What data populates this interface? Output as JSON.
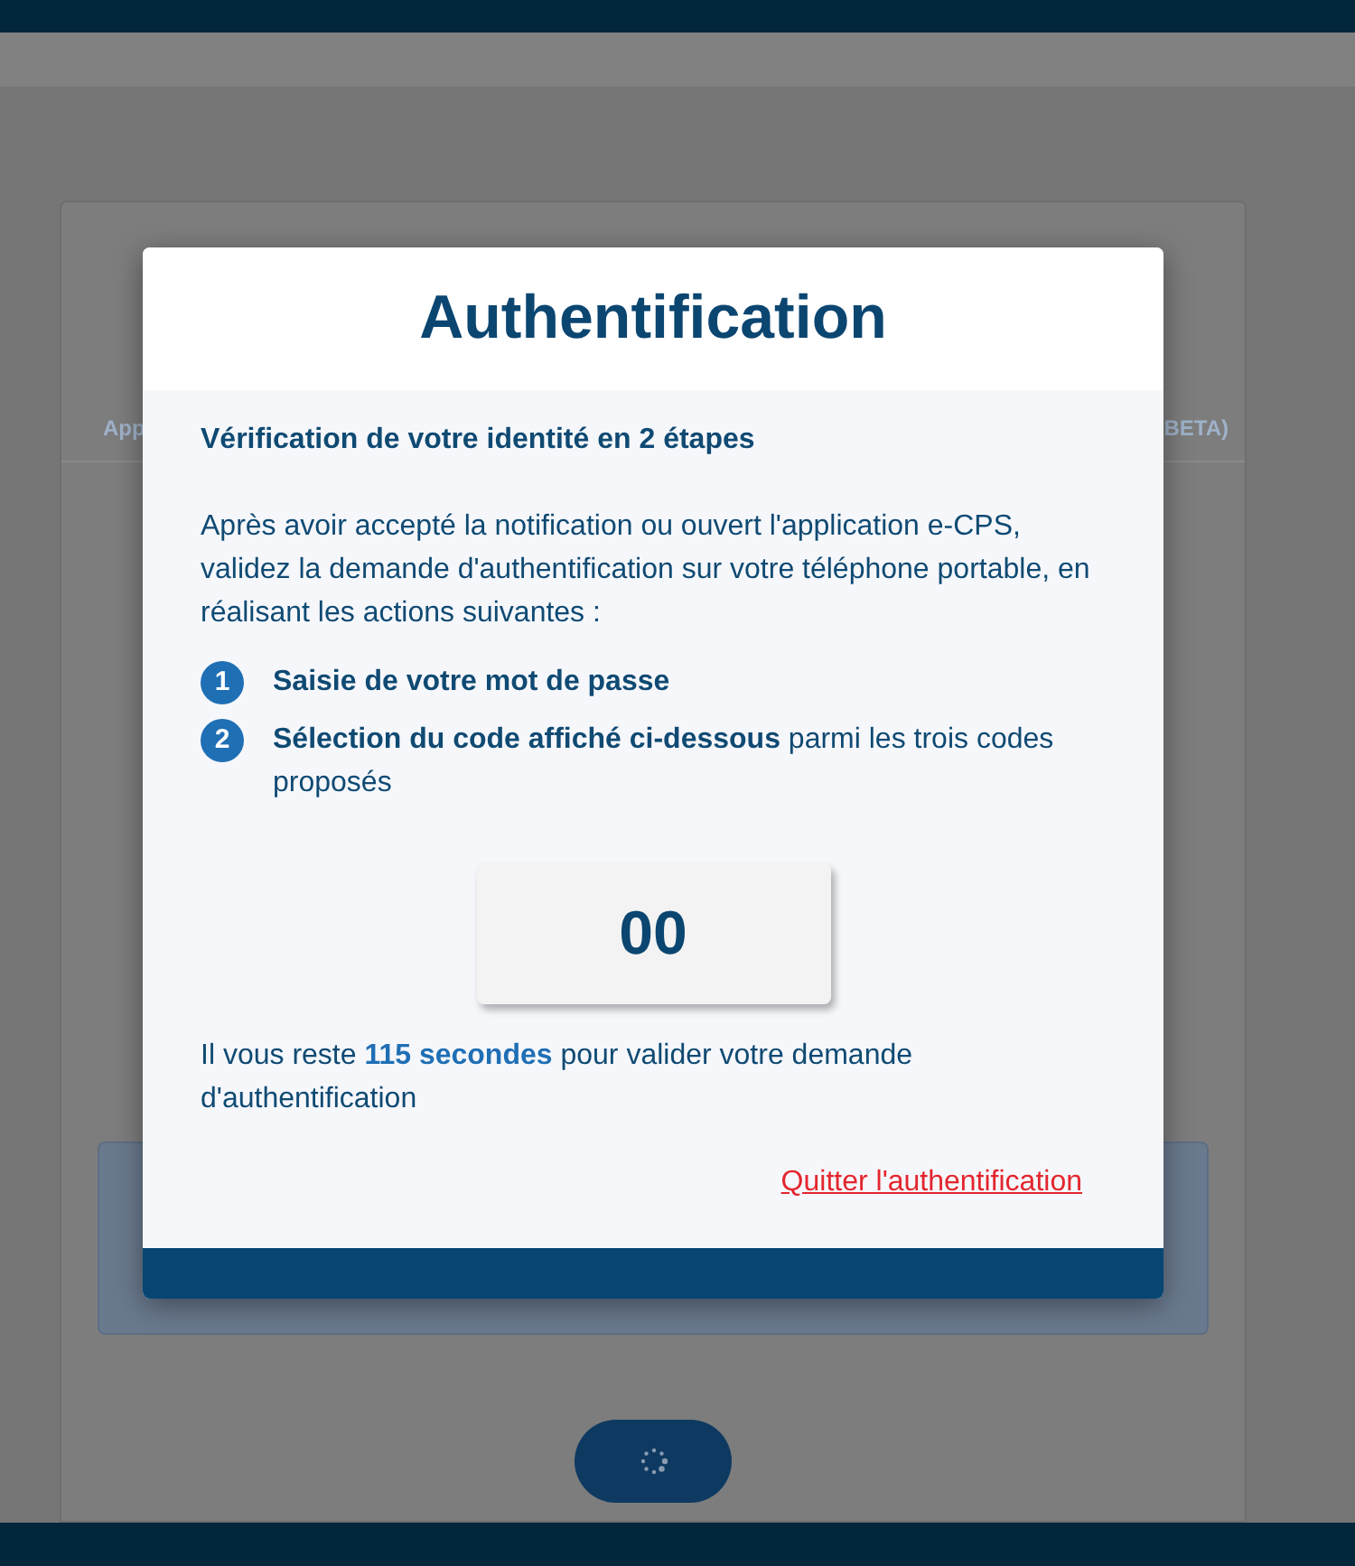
{
  "background": {
    "tabs": [
      {
        "label": "App"
      },
      {
        "label": "BETA)"
      }
    ]
  },
  "dialog": {
    "title": "Authentification",
    "subtitle": "Vérification de votre identité en 2 étapes",
    "intro": "Après avoir accepté la notification ou ouvert l'application e-CPS, validez la demande d'authentification sur votre téléphone portable, en réalisant les actions suivantes :",
    "steps": [
      {
        "number": "1",
        "text": "Saisie de votre mot de passe",
        "bold": true
      },
      {
        "number": "2",
        "text": "**Sélection du code affiché ci-dessous** parmi les trois codes proposés",
        "bold": false
      }
    ],
    "code": "00",
    "timer": "Il vous reste **115 secondes** pour valider votre demande d'authentification",
    "quit_link": "Quitter l'authentification"
  }
}
